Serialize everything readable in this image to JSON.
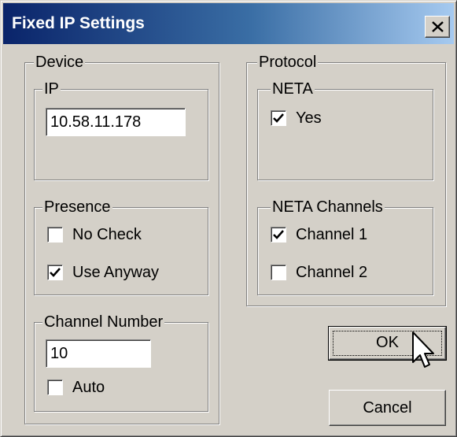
{
  "window": {
    "title": "Fixed IP Settings"
  },
  "device": {
    "legend": "Device",
    "ip": {
      "legend": "IP",
      "value": "10.58.11.178"
    },
    "presence": {
      "legend": "Presence",
      "options": [
        {
          "label": "No Check",
          "checked": false
        },
        {
          "label": "Use Anyway",
          "checked": true
        }
      ]
    },
    "channel_number": {
      "legend": "Channel Number",
      "value": "10",
      "auto": {
        "label": "Auto",
        "checked": false
      }
    }
  },
  "protocol": {
    "legend": "Protocol",
    "neta": {
      "legend": "NETA",
      "yes": {
        "label": "Yes",
        "checked": true
      }
    },
    "neta_channels": {
      "legend": "NETA Channels",
      "options": [
        {
          "label": "Channel 1",
          "checked": true
        },
        {
          "label": "Channel 2",
          "checked": false
        }
      ]
    }
  },
  "buttons": {
    "ok": "OK",
    "cancel": "Cancel"
  },
  "icons": {
    "close": "close-icon",
    "check": "check-icon",
    "cursor": "arrow-cursor-icon"
  },
  "colors": {
    "titlebar_start": "#0a246a",
    "titlebar_end": "#a6caf0",
    "face": "#d4d0c8"
  }
}
